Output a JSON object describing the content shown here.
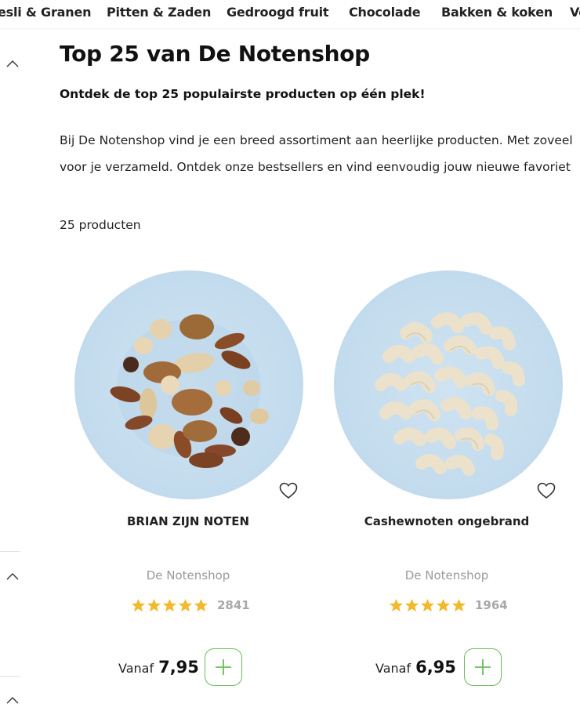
{
  "topnav": {
    "items": [
      {
        "label": "esli & Granen"
      },
      {
        "label": "Pitten & Zaden"
      },
      {
        "label": "Gedroogd fruit"
      },
      {
        "label": "Chocolade"
      },
      {
        "label": "Bakken & koken"
      },
      {
        "label": "Vo"
      }
    ]
  },
  "page": {
    "title": "Top 25 van De Notenshop",
    "subtitle": "Ontdek de top 25 populairste producten op één plek!",
    "intro_line1": "Bij De Notenshop vind je een breed assortiment aan heerlijke producten. Met zoveel",
    "intro_line2": "voor je verzameld. Ontdek onze bestsellers en vind eenvoudig jouw nieuwe favoriet",
    "product_count": "25 producten"
  },
  "products": [
    {
      "name": "BRIAN ZIJN NOTEN",
      "brand": "De Notenshop",
      "rating": 5,
      "review_count": "2841",
      "price_prefix": "Vanaf",
      "price": "7,95"
    },
    {
      "name": "Cashewnoten ongebrand",
      "brand": "De Notenshop",
      "rating": 5,
      "review_count": "1964",
      "price_prefix": "Vanaf",
      "price": "6,95"
    }
  ],
  "colors": {
    "accent_green": "#6bbb5a",
    "star_gold": "#f3b92c",
    "image_background": "#c4dcee"
  },
  "icons": [
    "chevron-up-icon",
    "heart-icon",
    "star-icon",
    "plus-icon"
  ]
}
